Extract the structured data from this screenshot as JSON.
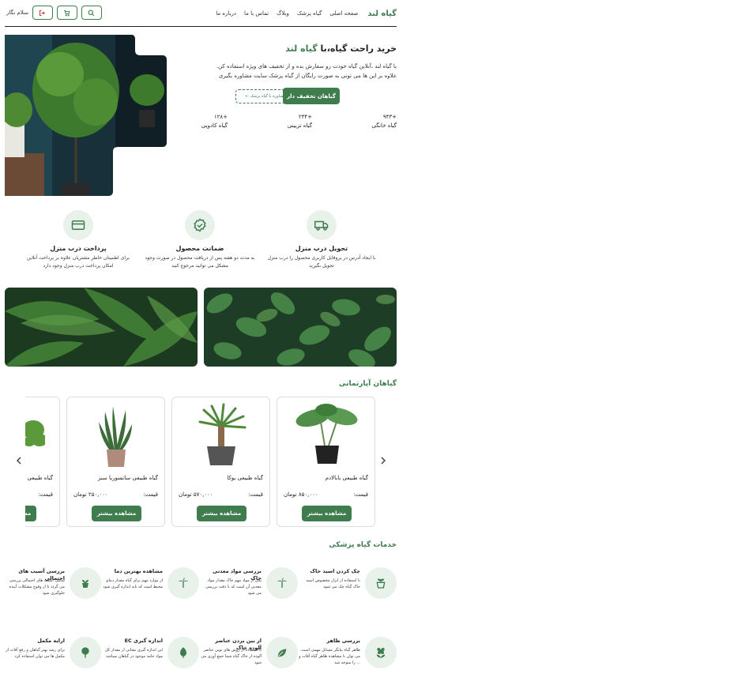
{
  "header": {
    "brand": "گیاه لند",
    "nav": [
      "صفحه اصلی",
      "گیاه پزشک",
      "وبلاگ",
      "تماس با ما",
      "درباره ما"
    ],
    "greeting": "سلام نگار"
  },
  "hero": {
    "title_part1": "خرید راحت گیاه،با ",
    "title_part2": "گیاه لند",
    "desc_line1": "با گیاه لند ،آنلاین گیاه خودت رو سفارش بده و از تخفیف های ویژه استفاده کن.",
    "desc_line2": "علاوه بر این ها می تونی به صورت رایگان از گیاه پزشک سایت مشاوره بگیری",
    "primary_button": "گیاهان تخفیف دار",
    "secondary_button": "مشاوره با گیاه پزشک ←",
    "stats": [
      {
        "value": "+۹۴۳",
        "label": "گیاه خانگی"
      },
      {
        "value": "+۲۳۴",
        "label": "گیاه تزیینی"
      },
      {
        "value": "+۱۲۸",
        "label": "گیاه کادویی"
      }
    ]
  },
  "features": [
    {
      "icon": "truck-icon",
      "title": "تحویل درب منزل",
      "desc": "با ایجاد آدرس در پروفایل کاربری محصول را درب منزل تحویل بگیرید"
    },
    {
      "icon": "badge-check-icon",
      "title": "ضمانت محصول",
      "desc": "به مدت دو هفته پس از دریافت محصول در صورت وجود مشکل می توانید مرجوع کنید"
    },
    {
      "icon": "credit-card-icon",
      "title": "پرداخت درب منزل",
      "desc": "برای اطمینان خاطر مشتریان علاوه بر پرداخت آنلاین امکان پرداخت درب منزل وجود دارد"
    }
  ],
  "apartment_section": {
    "title": "گیاهان آپارتمانی",
    "price_label": "قیمت:",
    "button": "مشاهده بیشتر",
    "products": [
      {
        "name": "گیاه طبیعی بابالادم",
        "price": "۸۵۰,۰۰۰ تومان"
      },
      {
        "name": "گیاه طبیعی یوکا",
        "price": "۵۷۰,۰۰۰ تومان"
      },
      {
        "name": "گیاه طبیعی سانسوریا سبز",
        "price": "۲۵۰,۰۰۰ تومان"
      },
      {
        "name": "گیاه طبیعی",
        "price": ""
      }
    ]
  },
  "services_section": {
    "title": "خدمات گیاه پزشکی",
    "items": [
      {
        "icon": "pot-icon",
        "title": "چک کردن اسید خاک",
        "desc": "با استفاده از ابزار مخصوص اسید خاک گیاه چک می شود"
      },
      {
        "icon": "palm-icon",
        "title": "بررسی مواد معدنی خاک",
        "desc": "یکی از مواد مهم خاک مقدار مواد معدنی آن است که با دقت بررسی می شود"
      },
      {
        "icon": "palm-icon",
        "title": "مشاهده بهترین دما",
        "desc": "از موارد مهم برای گیاه مقدار دمای محیط است که باید اندازه گیری شود"
      },
      {
        "icon": "plant-icon",
        "title": "بررسی آسیب های احتمالی",
        "desc": "تمامی آسیب های احتمالی بررسی می گردد تا از وقوع مشکلات آینده جلوگیری شود"
      },
      {
        "icon": "flower-icon",
        "title": "بررسی ظاهر",
        "desc": "ظاهر گیاه بیانگر مسایل مهمی است. می توان با مشاهده ظاهر گیاه آفات و ... را متوجه شد"
      },
      {
        "icon": "sprout-icon",
        "title": "از بین بردن عناصر آلوده خاک",
        "desc": "با استفاده از روش های نوین عناصر آلوده از خاک گیاه شما جمع آوری می شود"
      },
      {
        "icon": "bulb-icon",
        "title": "اندازه گیری EC",
        "desc": "این اندازه گیری نشانی از مقدار کل مواد جامد موجود در گیاهان میباشد"
      },
      {
        "icon": "tree-icon",
        "title": "ارایه مکمل",
        "desc": "برای رشد بهتر گیاهان و رفع آفات از مکمل ها می توان استفاده کرد"
      }
    ]
  },
  "colors": {
    "accent": "#3f7d4f",
    "accent_light": "#e8f1ea"
  }
}
